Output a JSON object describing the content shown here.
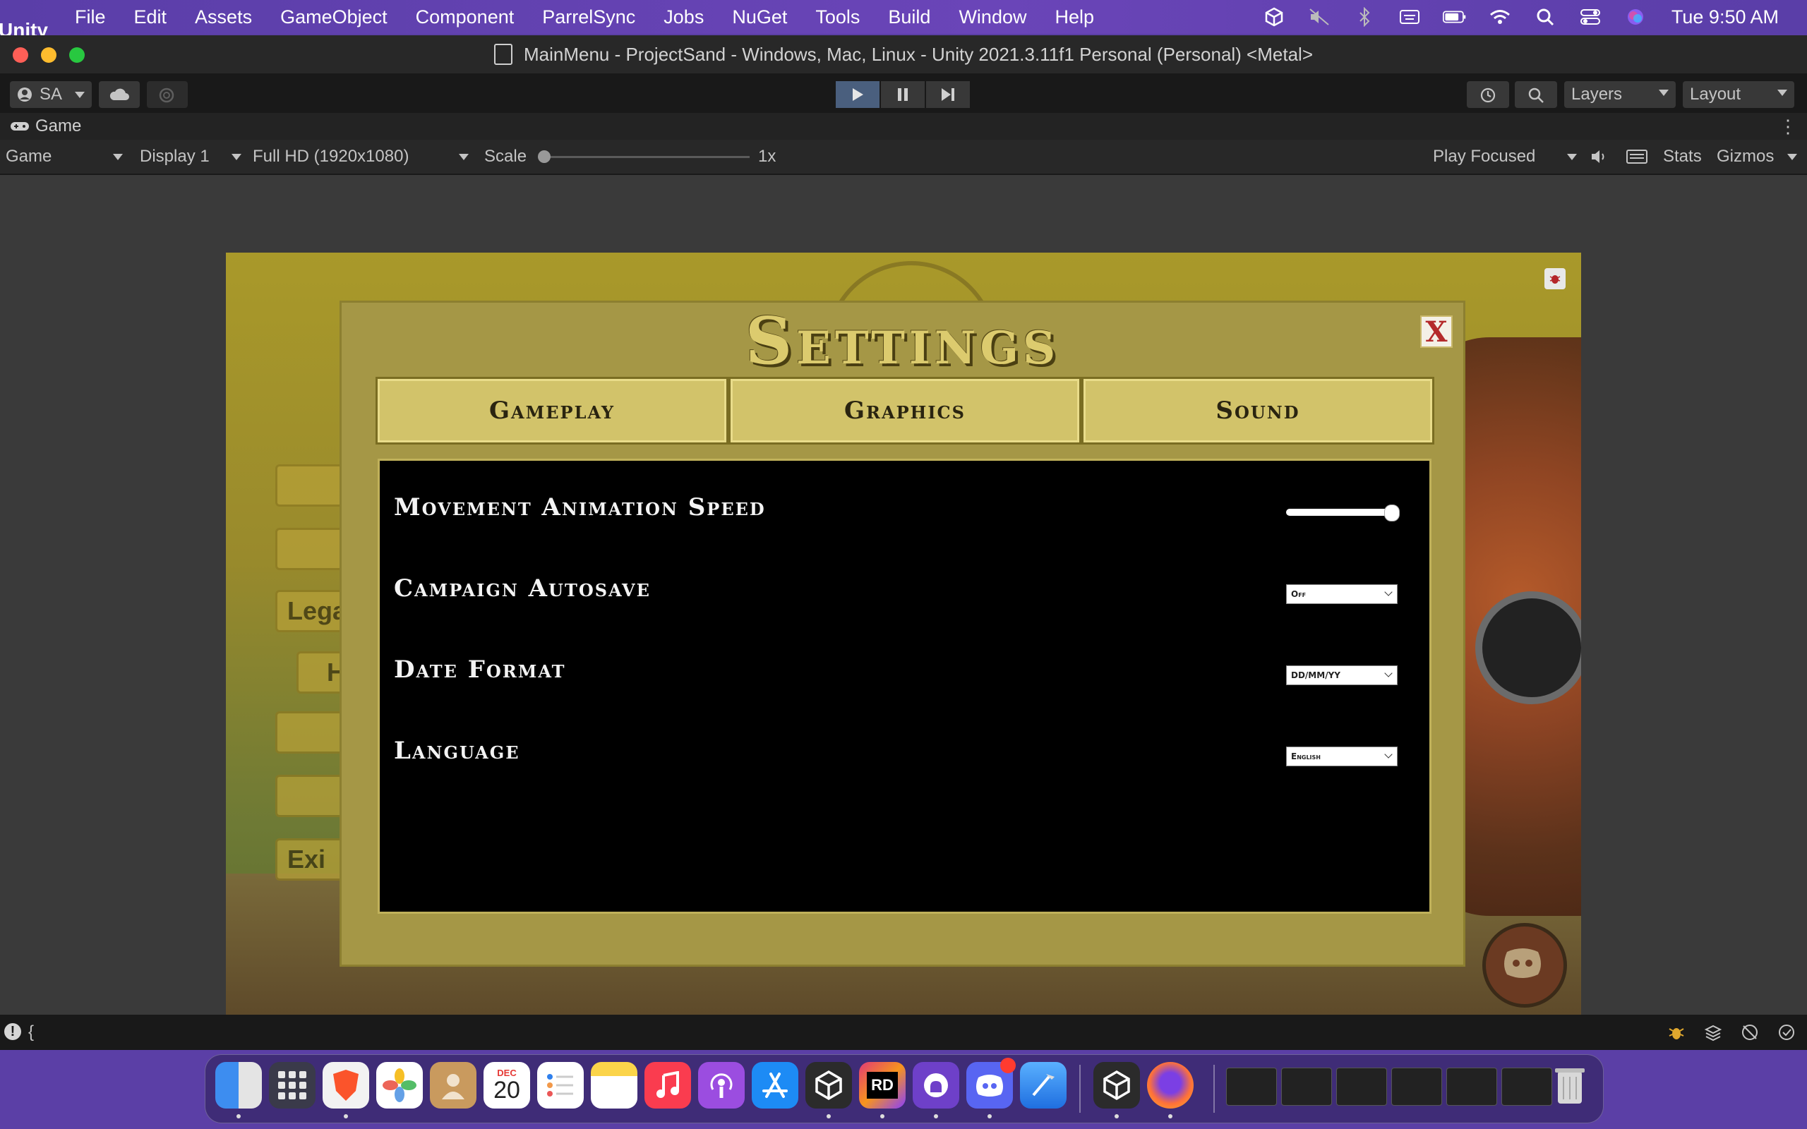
{
  "menubar": {
    "app": "Unity",
    "items": [
      "File",
      "Edit",
      "Assets",
      "GameObject",
      "Component",
      "ParrelSync",
      "Jobs",
      "NuGet",
      "Tools",
      "Build",
      "Window",
      "Help"
    ],
    "clock": "Tue  9:50 AM"
  },
  "window": {
    "title": "MainMenu - ProjectSand - Windows, Mac, Linux - Unity 2021.3.11f1 Personal (Personal) <Metal>"
  },
  "toolbar": {
    "account": "SA",
    "layers": "Layers",
    "layout": "Layout"
  },
  "game_tab": {
    "label": "Game",
    "view_mode": "Game",
    "display": "Display 1",
    "resolution": "Full HD (1920x1080)",
    "scale_label": "Scale",
    "scale_value": "1x",
    "play_mode": "Play Focused",
    "stats": "Stats",
    "gizmos": "Gizmos"
  },
  "background_menu": {
    "items": [
      "",
      "",
      "Lega",
      "H",
      "",
      "",
      "Exi"
    ]
  },
  "settings": {
    "title": "Settings",
    "close": "X",
    "tabs": [
      "Gameplay",
      "Graphics",
      "Sound"
    ],
    "rows": [
      {
        "label": "Movement Animation Speed",
        "control": "slider",
        "value": 1.0
      },
      {
        "label": "Campaign Autosave",
        "control": "dropdown",
        "value": "Off"
      },
      {
        "label": "Date Format",
        "control": "dropdown",
        "value": "DD/MM/YY"
      },
      {
        "label": "Language",
        "control": "dropdown",
        "value": "English"
      }
    ]
  },
  "statusbar": {
    "message": "{"
  },
  "dock": {
    "calendar_month": "DEC",
    "calendar_day": "20",
    "rider_label": "RD",
    "discord_badge": "1"
  }
}
